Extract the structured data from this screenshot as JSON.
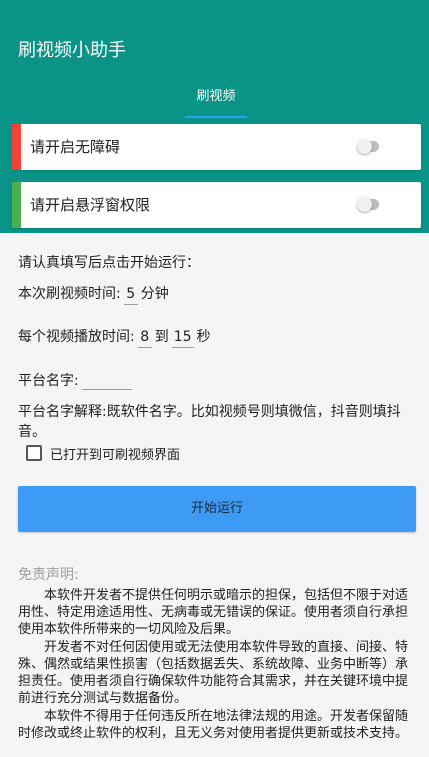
{
  "app": {
    "title": "刷视频小助手",
    "accent_color": "#0a9488"
  },
  "tabs": [
    {
      "label": "刷视频",
      "selected": true
    }
  ],
  "permissions": [
    {
      "label": "请开启无障碍",
      "status_color": "#f44336",
      "enabled": false
    },
    {
      "label": "请开启悬浮窗权限",
      "status_color": "#4caf50",
      "enabled": false
    }
  ],
  "form": {
    "intro": "请认真填写后点击开始运行：",
    "duration_label": "本次刷视频时间:",
    "duration_value": "5",
    "duration_unit": "分钟",
    "play_label": "每个视频播放时间:",
    "play_min": "8",
    "play_to": "到",
    "play_max": "15",
    "play_unit": "秒",
    "platform_label": "平台名字:",
    "platform_value": "",
    "platform_explain": "平台名字解释:既软件名字。比如视频号则填微信，抖音则填抖音。",
    "opened_checkbox_label": "已打开到可刷视频界面",
    "opened_checked": false
  },
  "start_button": {
    "label": "开始运行",
    "color": "#3d9bf5"
  },
  "disclaimer": {
    "title": "免责声明:",
    "paragraphs": [
      "本软件开发者不提供任何明示或暗示的担保，包括但不限于对适用性、特定用途适用性、无病毒或无错误的保证。使用者须自行承担使用本软件所带来的一切风险及后果。",
      "开发者不对任何因使用或无法使用本软件导致的直接、间接、特殊、偶然或结果性损害（包括数据丢失、系统故障、业务中断等）承担责任。使用者须自行确保软件功能符合其需求，并在关键环境中提前进行充分测试与数据备份。",
      "本软件不得用于任何违反所在地法律法规的用途。开发者保留随时修改或终止软件的权利，且无义务对使用者提供更新或技术支持。"
    ]
  }
}
